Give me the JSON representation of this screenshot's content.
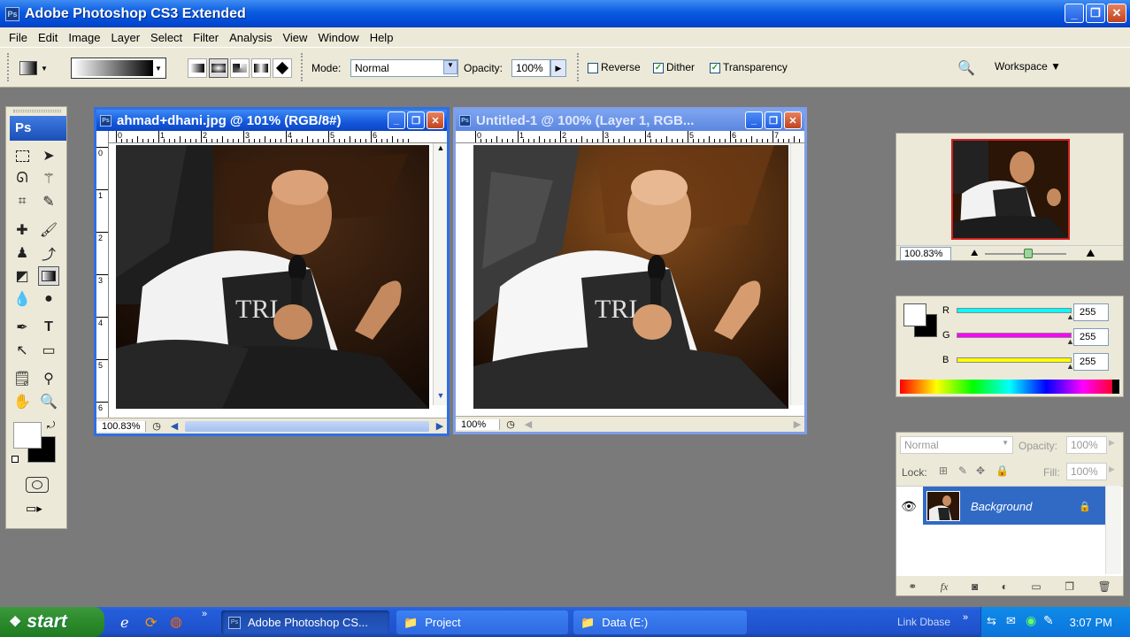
{
  "app": {
    "title": "Adobe Photoshop CS3 Extended",
    "ps_icon_text": "Ps"
  },
  "menu": [
    "File",
    "Edit",
    "Image",
    "Layer",
    "Select",
    "Filter",
    "Analysis",
    "View",
    "Window",
    "Help"
  ],
  "options": {
    "mode_label": "Mode:",
    "mode_value": "Normal",
    "opacity_label": "Opacity:",
    "opacity_value": "100%",
    "reverse_label": "Reverse",
    "reverse_checked": false,
    "dither_label": "Dither",
    "dither_checked": true,
    "transparency_label": "Transparency",
    "transparency_checked": true,
    "workspace_label": "Workspace"
  },
  "toolbox": {
    "logo": "Ps"
  },
  "doc1": {
    "title": "ahmad+dhani.jpg @ 101% (RGB/8#)",
    "zoom": "100.83%",
    "ruler_h": [
      "0",
      "1",
      "2",
      "3",
      "4",
      "5",
      "6"
    ],
    "ruler_v": [
      "0",
      "1",
      "2",
      "3",
      "4",
      "5",
      "6"
    ],
    "active": true
  },
  "doc2": {
    "title": "Untitled-1 @ 100% (Layer 1, RGB...",
    "zoom": "100%",
    "ruler_h": [
      "0",
      "1",
      "2",
      "3",
      "4",
      "5",
      "6",
      "7"
    ],
    "active": false
  },
  "navigator": {
    "zoom": "100.83%"
  },
  "color_panel": {
    "channels": [
      {
        "label": "R",
        "value": "255",
        "color": "#00ffff"
      },
      {
        "label": "G",
        "value": "255",
        "color": "#ff00ff"
      },
      {
        "label": "B",
        "value": "255",
        "color": "#ffff00"
      }
    ]
  },
  "layers_panel": {
    "blend_mode": "Normal",
    "opacity_label": "Opacity:",
    "opacity_value": "100%",
    "lock_label": "Lock:",
    "fill_label": "Fill:",
    "fill_value": "100%",
    "layers": [
      {
        "name": "Background",
        "visible": true,
        "locked": true,
        "selected": true
      }
    ]
  },
  "taskbar": {
    "start_label": "start",
    "buttons": [
      {
        "label": "Adobe Photoshop CS..."
      },
      {
        "label": "Project"
      },
      {
        "label": "Data (E:)"
      }
    ],
    "tray_text": "Link Dbase",
    "clock": "3:07 PM"
  },
  "colors": {
    "xp_blue": "#0a5be0",
    "panel_bg": "#ece9d8",
    "workspace_bg": "#7a7a7a",
    "selected_layer": "#316ac5"
  }
}
